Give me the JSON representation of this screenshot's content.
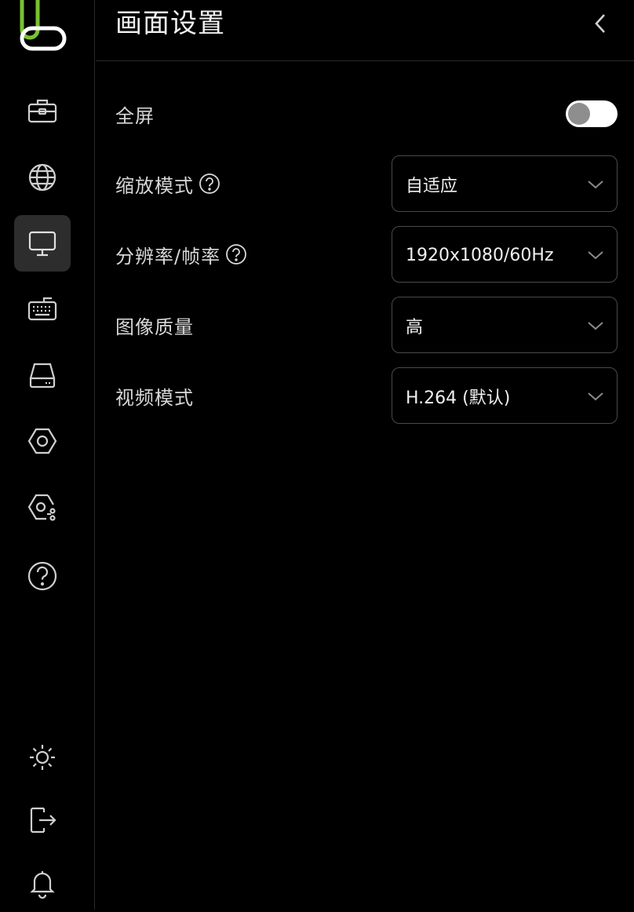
{
  "sidebar": {
    "logo": "app-logo",
    "nav_items": [
      {
        "id": "toolbox",
        "icon": "toolbox-icon"
      },
      {
        "id": "network",
        "icon": "globe-icon"
      },
      {
        "id": "display",
        "icon": "monitor-icon",
        "active": true
      },
      {
        "id": "keyboard",
        "icon": "keyboard-icon"
      },
      {
        "id": "storage",
        "icon": "drive-icon"
      },
      {
        "id": "settings",
        "icon": "hexagon-icon"
      },
      {
        "id": "advanced-settings",
        "icon": "hexagon-settings-icon"
      },
      {
        "id": "help",
        "icon": "help-circle-icon"
      }
    ],
    "bottom_items": [
      {
        "id": "theme",
        "icon": "sun-icon"
      },
      {
        "id": "logout",
        "icon": "logout-icon"
      },
      {
        "id": "notifications",
        "icon": "bell-icon"
      }
    ]
  },
  "header": {
    "title": "画面设置",
    "back_icon": "chevron-left-icon"
  },
  "settings": {
    "fullscreen": {
      "label": "全屏",
      "enabled": false
    },
    "scale_mode": {
      "label": "缩放模式",
      "value": "自适应"
    },
    "resolution": {
      "label": "分辨率/帧率",
      "value": "1920x1080/60Hz"
    },
    "image_quality": {
      "label": "图像质量",
      "value": "高"
    },
    "video_mode": {
      "label": "视频模式",
      "value": "H.264 (默认)"
    }
  },
  "colors": {
    "background": "#000000",
    "active_nav": "#2d2d2d",
    "logo_green": "#7ac231",
    "border": "#4a4a4a"
  }
}
